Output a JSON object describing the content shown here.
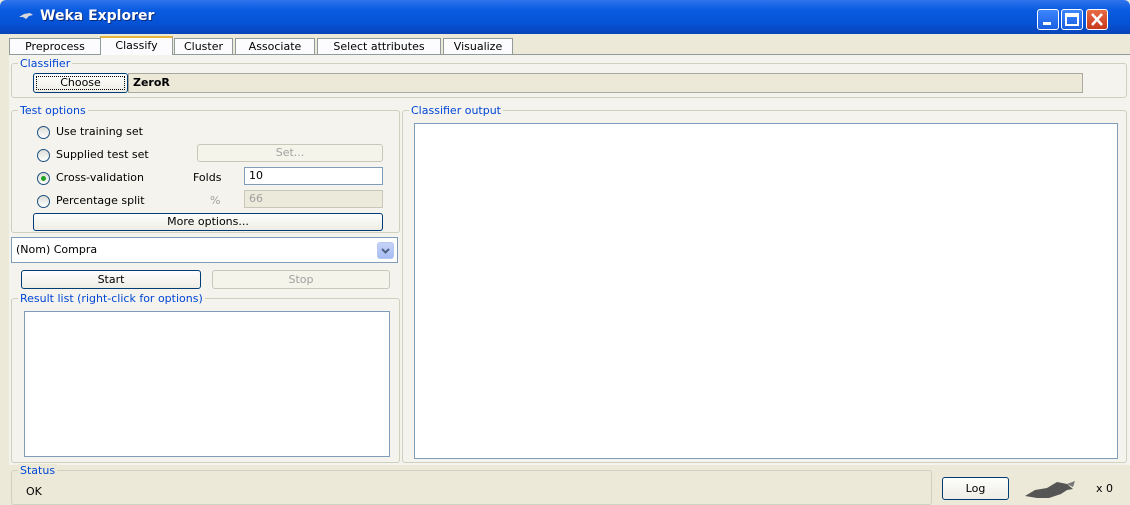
{
  "window": {
    "title": "Weka Explorer"
  },
  "tabs": [
    "Preprocess",
    "Classify",
    "Cluster",
    "Associate",
    "Select attributes",
    "Visualize"
  ],
  "classifier": {
    "group_label": "Classifier",
    "choose_label": "Choose",
    "name": "ZeroR"
  },
  "test_options": {
    "group_label": "Test options",
    "use_training_set": "Use training set",
    "supplied_test_set": "Supplied test set",
    "set_button": "Set...",
    "cross_validation": "Cross-validation",
    "folds_label": "Folds",
    "folds_value": "10",
    "percentage_split": "Percentage split",
    "percent_symbol": "%",
    "percent_value": "66",
    "selected": "cross_validation",
    "more_options": "More options..."
  },
  "class_attribute": {
    "value": "(Nom) Compra"
  },
  "actions": {
    "start": "Start",
    "stop": "Stop"
  },
  "result_list": {
    "group_label": "Result list (right-click for options)"
  },
  "classifier_output": {
    "group_label": "Classifier output"
  },
  "status": {
    "group_label": "Status",
    "text": "OK",
    "log_button": "Log",
    "tasks_count": "x 0"
  }
}
